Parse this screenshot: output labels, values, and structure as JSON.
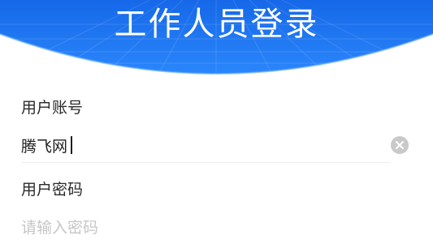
{
  "header": {
    "title": "工作人员登录"
  },
  "form": {
    "account": {
      "label": "用户账号",
      "value": "腾飞网"
    },
    "password": {
      "label": "用户密码",
      "placeholder": "请输入密码"
    }
  },
  "icons": {
    "clear": "close-circle-icon"
  },
  "colors": {
    "header_blue": "#1a73f0",
    "header_blue_light": "#3d92ff",
    "placeholder": "#c6c6c6",
    "clear_button": "#c9c9c9"
  }
}
